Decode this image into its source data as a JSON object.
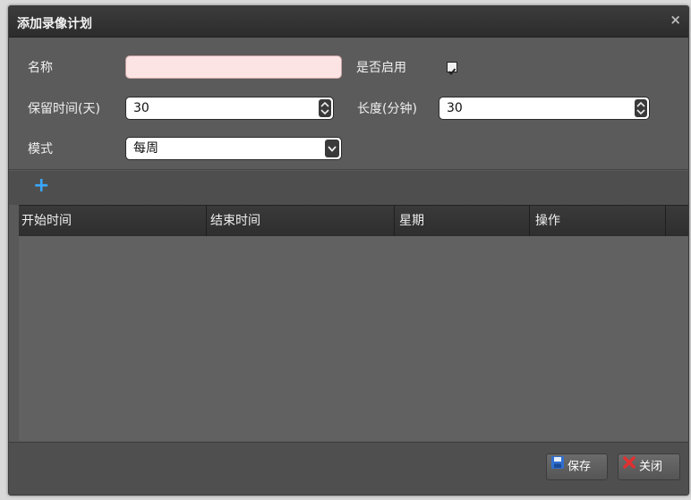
{
  "dialog": {
    "title": "添加录像计划",
    "close_glyph": "×"
  },
  "form": {
    "name_label": "名称",
    "name_value": "",
    "enabled_label": "是否启用",
    "enabled_checked": true,
    "retention_label": "保留时间(天)",
    "retention_value": "30",
    "length_label": "长度(分钟)",
    "length_value": "30",
    "mode_label": "模式",
    "mode_value": "每周"
  },
  "toolbar": {
    "add_glyph": "+"
  },
  "table": {
    "columns": [
      "开始时间",
      "结束时间",
      "星期",
      "操作"
    ],
    "rows": []
  },
  "footer": {
    "save_label": "保存",
    "close_label": "关闭"
  },
  "icons": {
    "add": "plus-icon",
    "save": "floppy-disk-icon",
    "close": "red-x-icon"
  },
  "colors": {
    "accent": "#3aa8ff",
    "close_icon": "#e03030",
    "save_icon": "#2f6fd1"
  }
}
